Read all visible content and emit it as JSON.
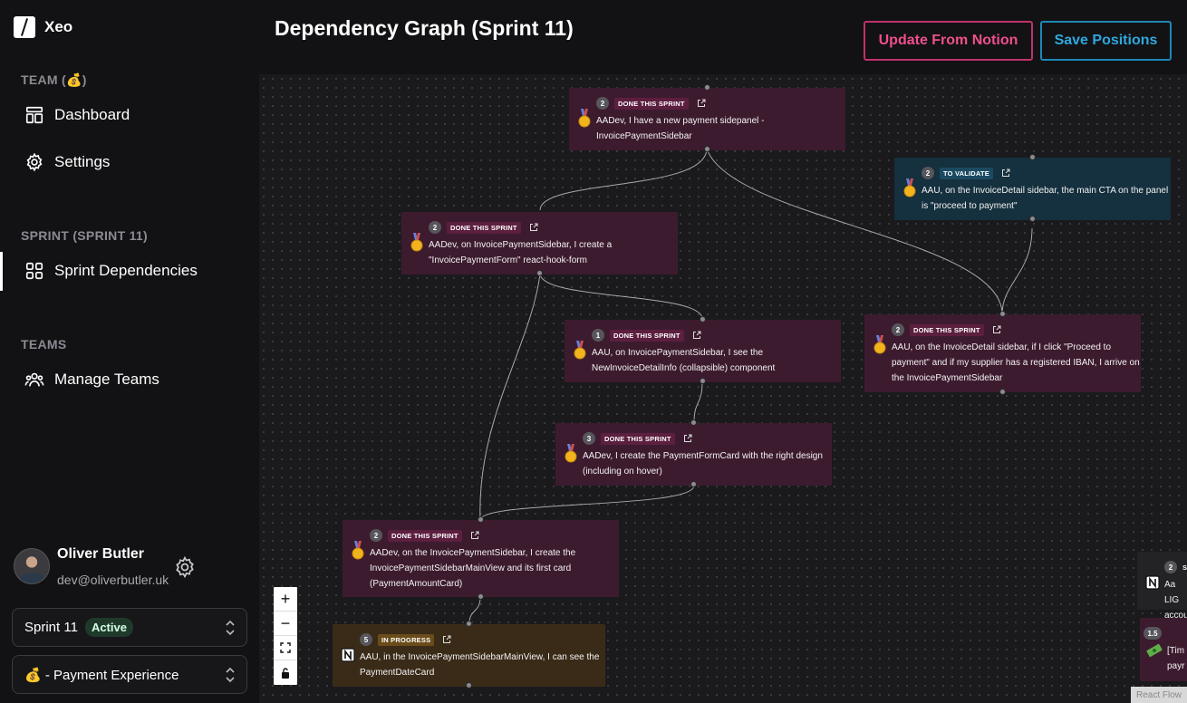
{
  "app": {
    "name": "Xeo"
  },
  "sidebar": {
    "team_label": "TEAM (💰)",
    "team_items": [
      {
        "label": "Dashboard",
        "icon": "dashboard-icon"
      },
      {
        "label": "Settings",
        "icon": "gear-icon"
      }
    ],
    "sprint_label": "SPRINT (SPRINT 11)",
    "sprint_items": [
      {
        "label": "Sprint Dependencies",
        "icon": "grid-icon",
        "active": true
      }
    ],
    "teams_label": "TEAMS",
    "teams_items": [
      {
        "label": "Manage Teams",
        "icon": "users-icon"
      }
    ]
  },
  "user": {
    "name": "Oliver Butler",
    "email": "dev@oliverbutler.uk"
  },
  "sprint_select": {
    "value": "Sprint 11",
    "badge": "Active"
  },
  "team_select": {
    "value": "💰 - Payment Experience"
  },
  "header": {
    "title": "Dependency Graph (Sprint 11)",
    "update_button": "Update From Notion",
    "save_button": "Save Positions"
  },
  "colors": {
    "done": "#3d1b2f",
    "validate": "#15303e",
    "progress": "#3a2b18",
    "notion_button": "#ef4f8c",
    "save_button": "#2fa8de"
  },
  "graph": {
    "nodes": [
      {
        "id": "n1",
        "points": "2",
        "status": "DONE THIS SPRINT",
        "icon": "medal-icon",
        "line1": "AADev, I have a new payment sidepanel -",
        "line2": "InvoicePaymentSidebar",
        "line3": ""
      },
      {
        "id": "n2",
        "points": "2",
        "status": "TO VALIDATE",
        "icon": "medal-icon",
        "line1": "AAU, on the InvoiceDetail sidebar, the main CTA on the panel",
        "line2": "is \"proceed to payment\"",
        "line3": ""
      },
      {
        "id": "n3",
        "points": "2",
        "status": "DONE THIS SPRINT",
        "icon": "medal-icon",
        "line1": "AADev, on InvoicePaymentSidebar, I create a",
        "line2": "\"InvoicePaymentForm\" react-hook-form",
        "line3": ""
      },
      {
        "id": "n4",
        "points": "1",
        "status": "DONE THIS SPRINT",
        "icon": "medal-icon",
        "line1": "AAU, on InvoicePaymentSidebar, I see the",
        "line2": "NewInvoiceDetailInfo (collapsible) component",
        "line3": ""
      },
      {
        "id": "n5",
        "points": "2",
        "status": "DONE THIS SPRINT",
        "icon": "medal-icon",
        "line1": "AAU, on the InvoiceDetail sidebar, if I click \"Proceed to",
        "line2": "payment\" and if my supplier has a registered IBAN, I arrive on",
        "line3": "the InvoicePaymentSidebar"
      },
      {
        "id": "n6",
        "points": "3",
        "status": "DONE THIS SPRINT",
        "icon": "medal-icon",
        "line1": "AADev, I create the PaymentFormCard with the right design",
        "line2": "(including on hover)",
        "line3": ""
      },
      {
        "id": "n7",
        "points": "2",
        "status": "DONE THIS SPRINT",
        "icon": "medal-icon",
        "line1": "AADev, on the InvoicePaymentSidebar, I create the",
        "line2": "InvoicePaymentSidebarMainView and its first card",
        "line3": "(PaymentAmountCard)"
      },
      {
        "id": "n8",
        "points": "5",
        "status": "IN PROGRESS",
        "icon": "notion-icon",
        "line1": "AAU, in the InvoicePaymentSidebarMainView, I can see the",
        "line2": "PaymentDateCard",
        "line3": ""
      },
      {
        "id": "n9",
        "points": "2",
        "status": "S",
        "icon": "notion-icon",
        "line1": "Aa LIG",
        "line2": "accou",
        "line3": ""
      },
      {
        "id": "n10",
        "points": "1.5",
        "status": "",
        "icon": "money-icon",
        "line1": "[Tim",
        "line2": "payr",
        "line3": ""
      }
    ],
    "controls": {
      "zoom_in": "+",
      "zoom_out": "−"
    },
    "attribution": "React Flow"
  }
}
